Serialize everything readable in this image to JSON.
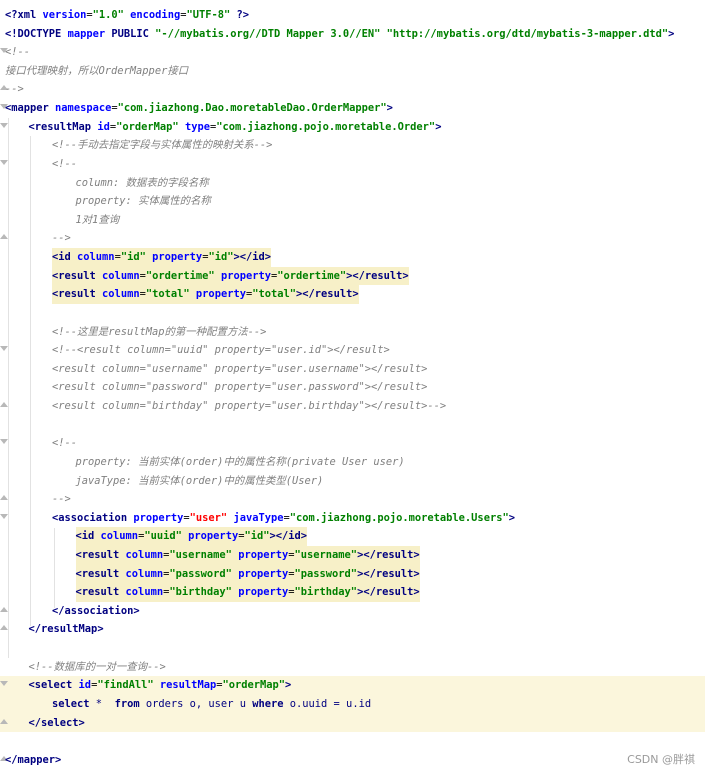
{
  "lines": [
    {
      "indent": 0,
      "hl": "",
      "fold": "",
      "tokens": [
        [
          "decl",
          "<?"
        ],
        [
          "decl",
          "xml "
        ],
        [
          "attr",
          "version"
        ],
        [
          "plain",
          "="
        ],
        [
          "val",
          "\"1.0\""
        ],
        [
          "plain",
          " "
        ],
        [
          "attr",
          "encoding"
        ],
        [
          "plain",
          "="
        ],
        [
          "val",
          "\"UTF-8\""
        ],
        [
          "plain",
          " "
        ],
        [
          "decl",
          "?>"
        ]
      ]
    },
    {
      "indent": 0,
      "hl": "",
      "fold": "",
      "tokens": [
        [
          "tag",
          "<!DOCTYPE "
        ],
        [
          "attr",
          "mapper"
        ],
        [
          "tag",
          " PUBLIC "
        ],
        [
          "val",
          "\"-//mybatis.org//DTD Mapper 3.0//EN\""
        ],
        [
          "plain",
          " "
        ],
        [
          "val",
          "\"http://mybatis.org/dtd/mybatis-3-mapper.dtd\""
        ],
        [
          "tag",
          ">"
        ]
      ]
    },
    {
      "indent": 0,
      "hl": "",
      "fold": "open",
      "tokens": [
        [
          "com",
          "<!--"
        ]
      ]
    },
    {
      "indent": 0,
      "hl": "",
      "fold": "",
      "tokens": [
        [
          "com",
          "接口代理映射，所以OrderMapper接口"
        ]
      ]
    },
    {
      "indent": 0,
      "hl": "",
      "fold": "close",
      "tokens": [
        [
          "com",
          "-->"
        ]
      ]
    },
    {
      "indent": 0,
      "hl": "",
      "fold": "open",
      "tokens": [
        [
          "tag",
          "<mapper "
        ],
        [
          "attr",
          "namespace"
        ],
        [
          "plain",
          "="
        ],
        [
          "val",
          "\"com.jiazhong.Dao.moretableDao.OrderMapper\""
        ],
        [
          "tag",
          ">"
        ]
      ]
    },
    {
      "indent": 1,
      "hl": "",
      "fold": "open",
      "tokens": [
        [
          "tag",
          "<resultMap "
        ],
        [
          "attr",
          "id"
        ],
        [
          "plain",
          "="
        ],
        [
          "val",
          "\"orderMap\""
        ],
        [
          "plain",
          " "
        ],
        [
          "attr",
          "type"
        ],
        [
          "plain",
          "="
        ],
        [
          "val",
          "\"com.jiazhong.pojo.moretable.Order\""
        ],
        [
          "tag",
          ">"
        ]
      ]
    },
    {
      "indent": 2,
      "hl": "",
      "fold": "",
      "tokens": [
        [
          "com",
          "<!--手动去指定字段与实体属性的映射关系-->"
        ]
      ]
    },
    {
      "indent": 2,
      "hl": "",
      "fold": "open",
      "tokens": [
        [
          "com",
          "<!--"
        ]
      ]
    },
    {
      "indent": 3,
      "hl": "",
      "fold": "",
      "tokens": [
        [
          "com",
          "column: 数据表的字段名称"
        ]
      ]
    },
    {
      "indent": 3,
      "hl": "",
      "fold": "",
      "tokens": [
        [
          "com",
          "property: 实体属性的名称"
        ]
      ]
    },
    {
      "indent": 3,
      "hl": "",
      "fold": "",
      "tokens": [
        [
          "com",
          "1对1查询"
        ]
      ]
    },
    {
      "indent": 2,
      "hl": "",
      "fold": "close",
      "tokens": [
        [
          "com",
          "-->"
        ]
      ]
    },
    {
      "indent": 2,
      "hl": "code",
      "fold": "",
      "tokens": [
        [
          "tag",
          "<id "
        ],
        [
          "attr",
          "column"
        ],
        [
          "plain",
          "="
        ],
        [
          "val",
          "\"id\""
        ],
        [
          "plain",
          " "
        ],
        [
          "attr",
          "property"
        ],
        [
          "plain",
          "="
        ],
        [
          "val",
          "\"id\""
        ],
        [
          "tag",
          "></id>"
        ]
      ]
    },
    {
      "indent": 2,
      "hl": "code",
      "fold": "",
      "tokens": [
        [
          "tag",
          "<result "
        ],
        [
          "attr",
          "column"
        ],
        [
          "plain",
          "="
        ],
        [
          "val",
          "\"ordertime\""
        ],
        [
          "plain",
          " "
        ],
        [
          "attr",
          "property"
        ],
        [
          "plain",
          "="
        ],
        [
          "val",
          "\"ordertime\""
        ],
        [
          "tag",
          "></result>"
        ]
      ]
    },
    {
      "indent": 2,
      "hl": "code",
      "fold": "",
      "tokens": [
        [
          "tag",
          "<result "
        ],
        [
          "attr",
          "column"
        ],
        [
          "plain",
          "="
        ],
        [
          "val",
          "\"total\""
        ],
        [
          "plain",
          " "
        ],
        [
          "attr",
          "property"
        ],
        [
          "plain",
          "="
        ],
        [
          "val",
          "\"total\""
        ],
        [
          "tag",
          "></result>"
        ]
      ]
    },
    {
      "indent": 0,
      "hl": "",
      "fold": "",
      "tokens": []
    },
    {
      "indent": 2,
      "hl": "",
      "fold": "",
      "tokens": [
        [
          "com",
          "<!--这里是resultMap的第一种配置方法-->"
        ]
      ]
    },
    {
      "indent": 2,
      "hl": "",
      "fold": "open",
      "tokens": [
        [
          "com",
          "<!--<result column=\"uuid\" property=\"user.id\"></result>"
        ]
      ]
    },
    {
      "indent": 2,
      "hl": "",
      "fold": "",
      "tokens": [
        [
          "com",
          "<result column=\"username\" property=\"user.username\"></result>"
        ]
      ]
    },
    {
      "indent": 2,
      "hl": "",
      "fold": "",
      "tokens": [
        [
          "com",
          "<result column=\"password\" property=\"user.password\"></result>"
        ]
      ]
    },
    {
      "indent": 2,
      "hl": "",
      "fold": "close",
      "tokens": [
        [
          "com",
          "<result column=\"birthday\" property=\"user.birthday\"></result>-->"
        ]
      ]
    },
    {
      "indent": 0,
      "hl": "",
      "fold": "",
      "tokens": []
    },
    {
      "indent": 2,
      "hl": "",
      "fold": "open",
      "tokens": [
        [
          "com",
          "<!--"
        ]
      ]
    },
    {
      "indent": 3,
      "hl": "",
      "fold": "",
      "tokens": [
        [
          "com",
          "property: 当前实体(order)中的属性名称(private User user)"
        ]
      ]
    },
    {
      "indent": 3,
      "hl": "",
      "fold": "",
      "tokens": [
        [
          "com",
          "javaType: 当前实体(order)中的属性类型(User)"
        ]
      ]
    },
    {
      "indent": 2,
      "hl": "",
      "fold": "close",
      "tokens": [
        [
          "com",
          "-->"
        ]
      ]
    },
    {
      "indent": 2,
      "hl": "",
      "fold": "open",
      "tokens": [
        [
          "tag",
          "<association "
        ],
        [
          "attr",
          "property"
        ],
        [
          "plain",
          "="
        ],
        [
          "red",
          "\"user\""
        ],
        [
          "plain",
          " "
        ],
        [
          "attr",
          "javaType"
        ],
        [
          "plain",
          "="
        ],
        [
          "val",
          "\"com.jiazhong.pojo.moretable.Users\""
        ],
        [
          "tag",
          ">"
        ]
      ]
    },
    {
      "indent": 3,
      "hl": "code",
      "fold": "",
      "tokens": [
        [
          "tag",
          "<id "
        ],
        [
          "attr",
          "column"
        ],
        [
          "plain",
          "="
        ],
        [
          "val",
          "\"uuid\""
        ],
        [
          "plain",
          " "
        ],
        [
          "attr",
          "property"
        ],
        [
          "plain",
          "="
        ],
        [
          "val",
          "\"id\""
        ],
        [
          "tag",
          "></id>"
        ]
      ]
    },
    {
      "indent": 3,
      "hl": "code",
      "fold": "",
      "tokens": [
        [
          "tag",
          "<result "
        ],
        [
          "attr",
          "column"
        ],
        [
          "plain",
          "="
        ],
        [
          "val",
          "\"username\""
        ],
        [
          "plain",
          " "
        ],
        [
          "attr",
          "property"
        ],
        [
          "plain",
          "="
        ],
        [
          "val",
          "\"username\""
        ],
        [
          "tag",
          "></result>"
        ]
      ]
    },
    {
      "indent": 3,
      "hl": "code",
      "fold": "",
      "tokens": [
        [
          "tag",
          "<result "
        ],
        [
          "attr",
          "column"
        ],
        [
          "plain",
          "="
        ],
        [
          "val",
          "\"password\""
        ],
        [
          "plain",
          " "
        ],
        [
          "attr",
          "property"
        ],
        [
          "plain",
          "="
        ],
        [
          "val",
          "\"password\""
        ],
        [
          "tag",
          "></result>"
        ]
      ]
    },
    {
      "indent": 3,
      "hl": "code",
      "fold": "",
      "tokens": [
        [
          "tag",
          "<result "
        ],
        [
          "attr",
          "column"
        ],
        [
          "plain",
          "="
        ],
        [
          "val",
          "\"birthday\""
        ],
        [
          "plain",
          " "
        ],
        [
          "attr",
          "property"
        ],
        [
          "plain",
          "="
        ],
        [
          "val",
          "\"birthday\""
        ],
        [
          "tag",
          "></result>"
        ]
      ]
    },
    {
      "indent": 2,
      "hl": "",
      "fold": "close",
      "tokens": [
        [
          "tag",
          "</association>"
        ]
      ]
    },
    {
      "indent": 1,
      "hl": "",
      "fold": "close",
      "tokens": [
        [
          "tag",
          "</resultMap>"
        ]
      ]
    },
    {
      "indent": 0,
      "hl": "",
      "fold": "",
      "tokens": []
    },
    {
      "indent": 1,
      "hl": "",
      "fold": "",
      "tokens": [
        [
          "com",
          "<!--数据库的一对一查询-->"
        ]
      ]
    },
    {
      "indent": 1,
      "hl": "full",
      "fold": "open",
      "tokens": [
        [
          "tag",
          "<select "
        ],
        [
          "attr",
          "id"
        ],
        [
          "plain",
          "="
        ],
        [
          "val",
          "\"findAll\""
        ],
        [
          "plain",
          " "
        ],
        [
          "attr",
          "resultMap"
        ],
        [
          "plain",
          "="
        ],
        [
          "val",
          "\"orderMap\""
        ],
        [
          "tag",
          ">"
        ]
      ]
    },
    {
      "indent": 2,
      "hl": "full",
      "fold": "",
      "tokens": [
        [
          "sqlk",
          "select"
        ],
        [
          "sql",
          " *  "
        ],
        [
          "sqlk",
          "from"
        ],
        [
          "sql",
          " orders o, user u "
        ],
        [
          "sqlk",
          "where"
        ],
        [
          "sql",
          " o.uuid = u.id"
        ]
      ]
    },
    {
      "indent": 1,
      "hl": "full",
      "fold": "close",
      "tokens": [
        [
          "tag",
          "</select>"
        ]
      ]
    },
    {
      "indent": 0,
      "hl": "",
      "fold": "",
      "tokens": []
    },
    {
      "indent": 0,
      "hl": "",
      "fold": "close",
      "tokens": [
        [
          "tag",
          "</mapper>"
        ]
      ]
    }
  ],
  "watermark": "CSDN @胖祺"
}
